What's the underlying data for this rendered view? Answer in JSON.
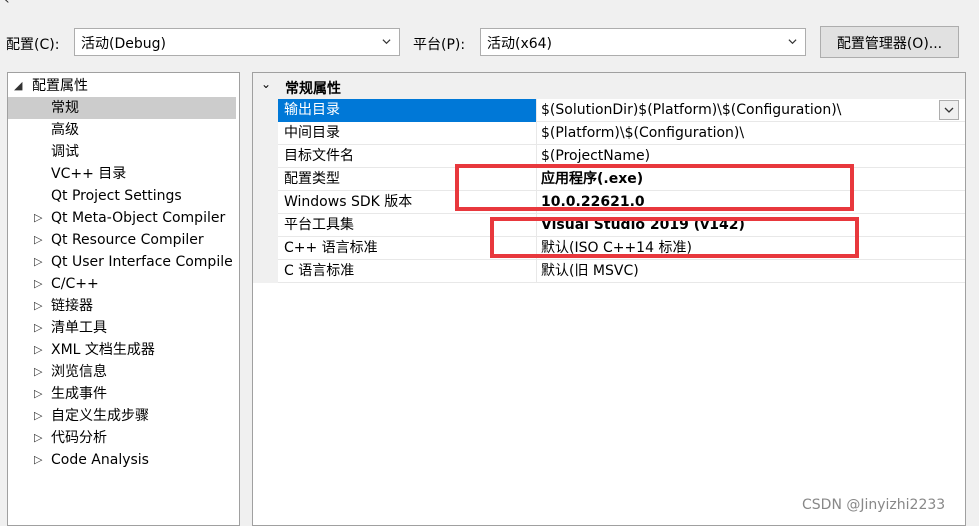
{
  "toolbar": {
    "config_label": "配置(C):",
    "config_value": "活动(Debug)",
    "platform_label": "平台(P):",
    "platform_value": "活动(x64)",
    "manager_button": "配置管理器(O)..."
  },
  "tree": {
    "root": "配置属性",
    "items": [
      {
        "label": "常规",
        "expandable": false,
        "selected": true
      },
      {
        "label": "高级",
        "expandable": false
      },
      {
        "label": "调试",
        "expandable": false
      },
      {
        "label": "VC++ 目录",
        "expandable": false
      },
      {
        "label": "Qt Project Settings",
        "expandable": false
      },
      {
        "label": "Qt Meta-Object Compiler",
        "expandable": true
      },
      {
        "label": "Qt Resource Compiler",
        "expandable": true
      },
      {
        "label": "Qt User Interface Compile",
        "expandable": true
      },
      {
        "label": "C/C++",
        "expandable": true
      },
      {
        "label": "链接器",
        "expandable": true
      },
      {
        "label": "清单工具",
        "expandable": true
      },
      {
        "label": "XML 文档生成器",
        "expandable": true
      },
      {
        "label": "浏览信息",
        "expandable": true
      },
      {
        "label": "生成事件",
        "expandable": true
      },
      {
        "label": "自定义生成步骤",
        "expandable": true
      },
      {
        "label": "代码分析",
        "expandable": true
      },
      {
        "label": "Code Analysis",
        "expandable": true
      }
    ]
  },
  "grid": {
    "section": "常规属性",
    "rows": [
      {
        "name": "输出目录",
        "value": "$(SolutionDir)$(Platform)\\$(Configuration)\\",
        "selected": true,
        "bold": false
      },
      {
        "name": "中间目录",
        "value": "$(Platform)\\$(Configuration)\\",
        "bold": false
      },
      {
        "name": "目标文件名",
        "value": "$(ProjectName)",
        "bold": false
      },
      {
        "name": "配置类型",
        "value": "应用程序(.exe)",
        "bold": true
      },
      {
        "name": "Windows SDK 版本",
        "value": "10.0.22621.0",
        "bold": true
      },
      {
        "name": "平台工具集",
        "value": "Visual Studio 2019 (v142)",
        "bold": true
      },
      {
        "name": "C++ 语言标准",
        "value": "默认(ISO C++14 标准)",
        "bold": false
      },
      {
        "name": "C 语言标准",
        "value": "默认(旧 MSVC)",
        "bold": false
      }
    ]
  },
  "watermark": "CSDN @Jinyizhi2233",
  "colors": {
    "selection": "#0078d7",
    "highlight_box": "#e8383d"
  }
}
